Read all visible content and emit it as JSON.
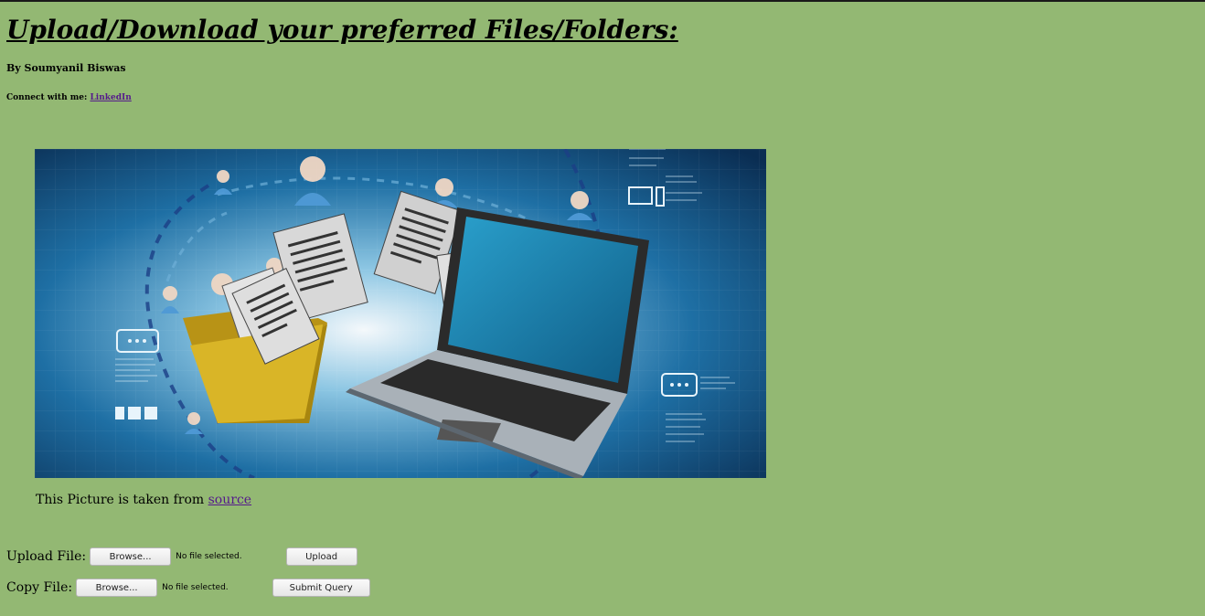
{
  "header": {
    "title": "Upload/Download your preferred Files/Folders:",
    "author": "By Soumyanil Biswas",
    "connect_prefix": "Connect with me: ",
    "connect_link": "LinkedIn"
  },
  "hero": {
    "caption_prefix": "This Picture is taken from ",
    "caption_link": "source",
    "colors": {
      "background": "#0d3f6e",
      "folder": "#d9b527",
      "laptop_screen": "#1c87b3"
    }
  },
  "upload_form": {
    "label": "Upload File:",
    "browse_label": "Browse...",
    "status": "No file selected.",
    "submit_label": "Upload"
  },
  "copy_form": {
    "label": "Copy File:",
    "browse_label": "Browse...",
    "status": "No file selected.",
    "submit_label": "Submit Query"
  },
  "theme": {
    "page_background": "#93b873",
    "link_color": "#551a8b"
  }
}
